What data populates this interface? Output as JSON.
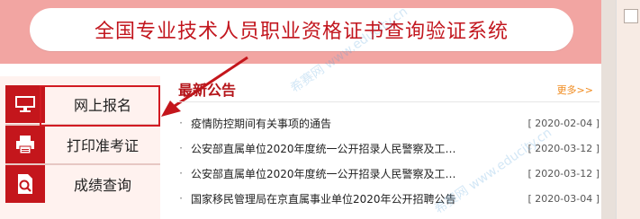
{
  "banner": {
    "title": "全国专业技术人员职业资格证书查询验证系统"
  },
  "menu": [
    {
      "label": "网上报名",
      "icon": "monitor-icon"
    },
    {
      "label": "打印准考证",
      "icon": "printer-icon"
    },
    {
      "label": "成绩查询",
      "icon": "search-document-icon"
    }
  ],
  "news": {
    "title": "最新公告",
    "more": "更多>>",
    "items": [
      {
        "text": "疫情防控期间有关事项的通告",
        "date": "[ 2020-02-04 ]"
      },
      {
        "text": "公安部直属单位2020年度统一公开招录人民警察及工…",
        "date": "[ 2020-03-12 ]"
      },
      {
        "text": "公安部直属单位2020年度统一公开招录人民警察及工…",
        "date": "[ 2020-03-12 ]"
      },
      {
        "text": "国家移民管理局在京直属事业单位2020年公开招聘公告",
        "date": "[ 2020-03-04 ]"
      }
    ]
  },
  "watermark": {
    "text": "希赛网 www.educity.cn"
  },
  "colors": {
    "accent": "#c4161c",
    "banner": "#f2a5a2",
    "more": "#f08a1d"
  }
}
